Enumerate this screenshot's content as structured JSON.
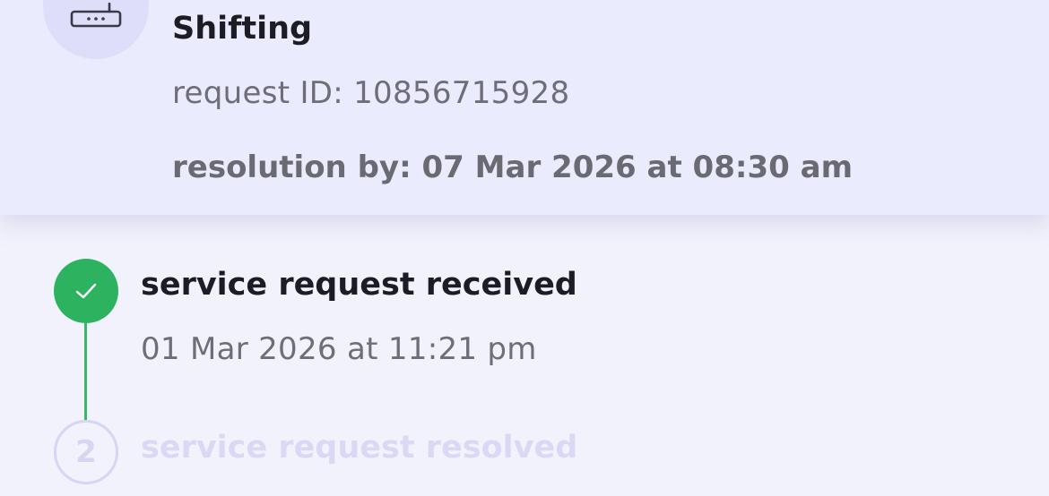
{
  "request": {
    "title": "Shifting",
    "request_id": "request ID: 10856715928",
    "resolution": "resolution by: 07 Mar 2026 at 08:30 am",
    "icon": "router-icon"
  },
  "timeline": {
    "steps": [
      {
        "number": "1",
        "title": "service request received",
        "time": "01 Mar 2026 at 11:21 pm",
        "status": "completed",
        "icon": "checkmark-icon"
      },
      {
        "number": "2",
        "title": "service request resolved",
        "status": "pending"
      }
    ]
  },
  "colors": {
    "card_background": "#ebebfe",
    "page_background": "#f2f2fc",
    "completed": "#2db35f",
    "pending": "#d6d6f4",
    "title_text": "#1c1c24",
    "secondary_text": "#6e6e78"
  }
}
